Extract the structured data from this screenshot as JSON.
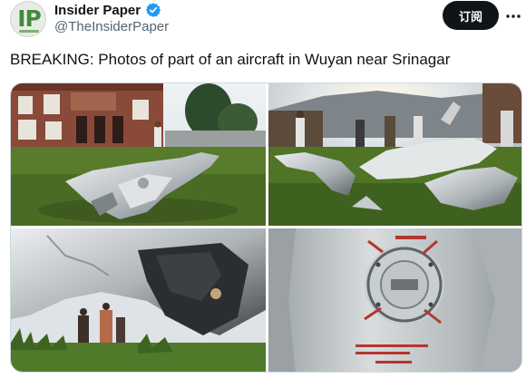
{
  "account": {
    "display_name": "Insider Paper",
    "handle": "@TheInsiderPaper",
    "avatar_text": "IP",
    "verified_icon": "verified-badge-icon",
    "verified_color": "#1d9bf0"
  },
  "actions": {
    "follow_label": "订阅",
    "more_icon": "more-options-icon"
  },
  "tweet": {
    "text": "BREAKING: Photos of part of an aircraft in Wuyan near Srinagar"
  },
  "media": [
    {
      "kind": "photo",
      "subject": "aircraft debris on lawn in front of brick building"
    },
    {
      "kind": "photo",
      "subject": "men inspecting scattered metal debris in field"
    },
    {
      "kind": "photo",
      "subject": "close-up of crumpled fuselage panel with people in background"
    },
    {
      "kind": "photo",
      "subject": "close-up of metal panel with circular fitting and red markings"
    }
  ],
  "colors": {
    "text_primary": "#0f1419",
    "text_secondary": "#536471",
    "button_bg": "#0f1419",
    "button_text": "#ffffff",
    "border": "#cfd9de"
  }
}
